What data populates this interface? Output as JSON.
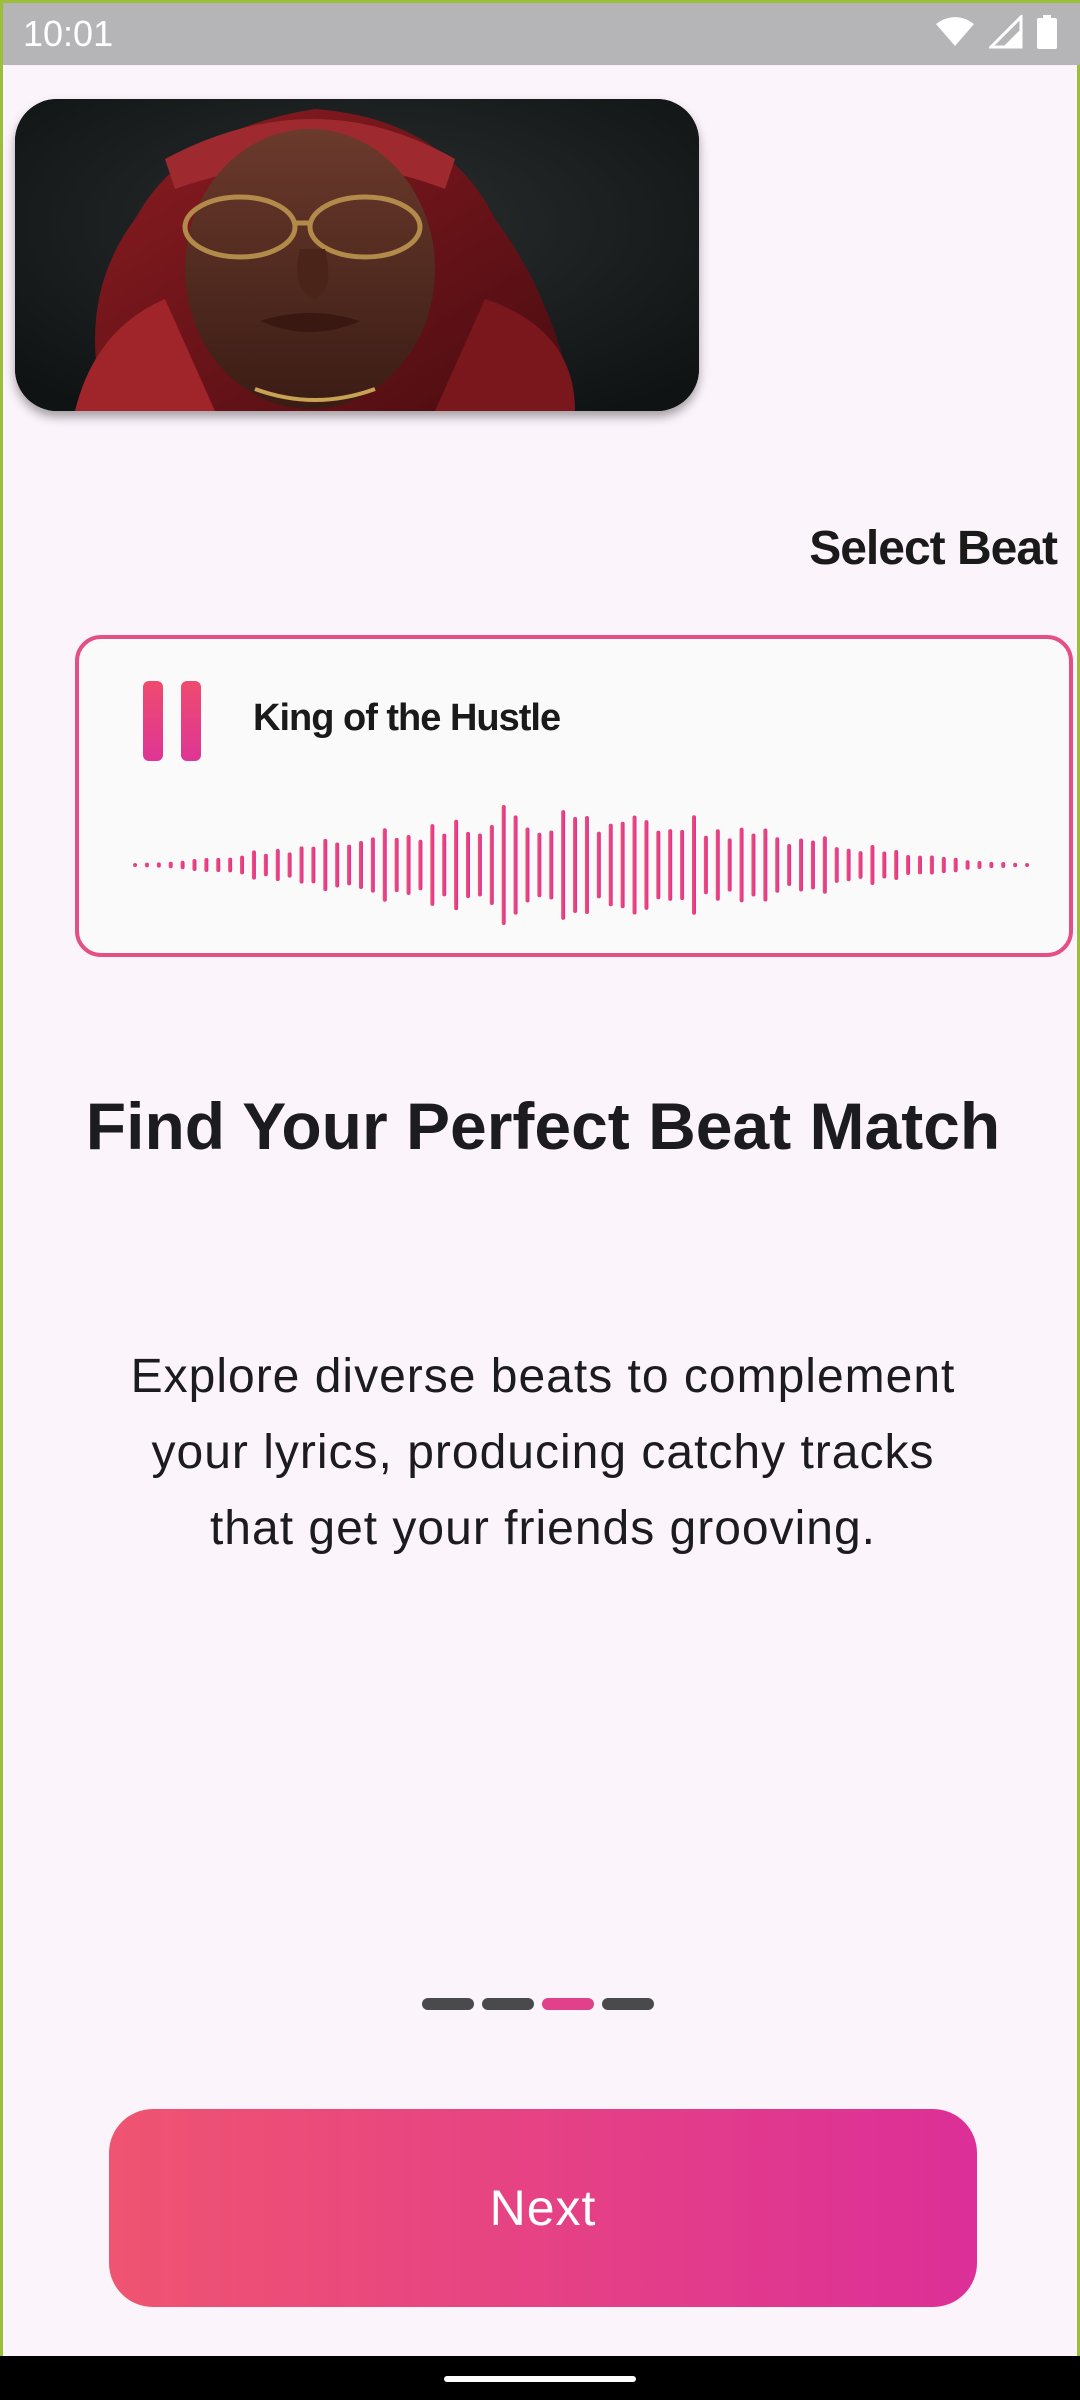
{
  "status_bar": {
    "time": "10:01",
    "icons": [
      "wifi-icon",
      "signal-icon",
      "battery-icon"
    ]
  },
  "hero": {
    "image": "artist-portrait"
  },
  "select_beat_label": "Select Beat",
  "beat_card": {
    "title": "King of the Hustle",
    "state": "playing",
    "control_icon": "pause-icon"
  },
  "headline": "Find Your Perfect Beat Match",
  "description": "Explore diverse beats to complement your lyrics, producing catchy tracks that get your friends grooving.",
  "pager": {
    "total": 4,
    "active_index": 2
  },
  "next_button": {
    "label": "Next"
  },
  "colors": {
    "accent_start": "#ef5471",
    "accent_end": "#dc2f98",
    "background": "#fcf4fb",
    "card_border": "#e44f86"
  }
}
